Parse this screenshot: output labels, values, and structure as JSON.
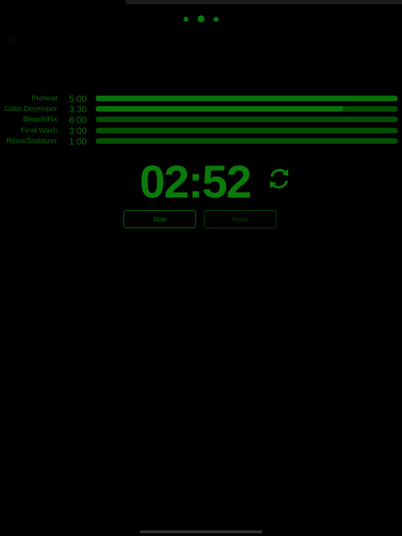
{
  "pager": {
    "pages": 3,
    "current": 1,
    "color": "#0a7a0a"
  },
  "favorite_icon": "star-outline-icon",
  "steps": [
    {
      "label": "Preheat",
      "time": "5:00",
      "progress": 1.0
    },
    {
      "label": "Color Developer",
      "time": "3:30",
      "progress": 0.82
    },
    {
      "label": "Bleach/Fix",
      "time": "6:00",
      "progress": 0
    },
    {
      "label": "Final Wash",
      "time": "3:00",
      "progress": 0
    },
    {
      "label": "Rinse/Stabilizer",
      "time": "1:00",
      "progress": 0
    }
  ],
  "timer": {
    "display": "02:52",
    "icon": "refresh-icon"
  },
  "buttons": {
    "stop": "Stop",
    "reset": "Reset"
  },
  "colors": {
    "accent": "#0a7a0a",
    "track": "#034f03",
    "background": "#000000"
  }
}
